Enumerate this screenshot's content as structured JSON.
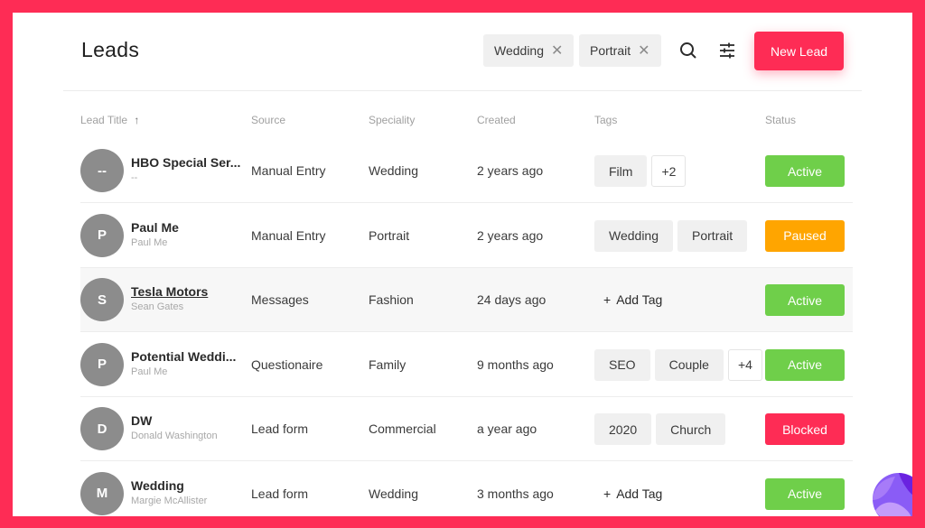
{
  "header": {
    "title": "Leads",
    "filters": [
      {
        "label": "Wedding",
        "remove_icon": "close-icon"
      },
      {
        "label": "Portrait",
        "remove_icon": "close-icon"
      }
    ],
    "search_icon": "search-icon",
    "filter_icon": "sliders-icon",
    "new_lead_label": "New Lead"
  },
  "colors": {
    "brand": "#fe2c55",
    "active": "#6fcf4a",
    "paused": "#ffa500",
    "blocked": "#fe2c55",
    "avatar": "#8c8c8c"
  },
  "table": {
    "columns": [
      "Lead Title",
      "Source",
      "Speciality",
      "Created",
      "Tags",
      "Status"
    ],
    "sort_icon": "arrow-up-icon",
    "add_tag_label": "Add Tag",
    "rows": [
      {
        "initial": "--",
        "title": "HBO Special Ser...",
        "subtitle": "--",
        "source": "Manual Entry",
        "speciality": "Wedding",
        "created": "2 years ago",
        "tags": [
          "Film"
        ],
        "more": "+2",
        "status": "Active"
      },
      {
        "initial": "P",
        "title": "Paul Me",
        "subtitle": "Paul Me",
        "source": "Manual Entry",
        "speciality": "Portrait",
        "created": "2 years ago",
        "tags": [
          "Wedding",
          "Portrait"
        ],
        "more": "",
        "status": "Paused"
      },
      {
        "initial": "S",
        "title": "Tesla Motors",
        "subtitle": "Sean Gates",
        "source": "Messages",
        "speciality": "Fashion",
        "created": "24 days ago",
        "tags": [],
        "more": "",
        "status": "Active"
      },
      {
        "initial": "P",
        "title": "Potential Weddi...",
        "subtitle": "Paul Me",
        "source": "Questionaire",
        "speciality": "Family",
        "created": "9 months ago",
        "tags": [
          "SEO",
          "Couple"
        ],
        "more": "+4",
        "status": "Active"
      },
      {
        "initial": "D",
        "title": "DW",
        "subtitle": "Donald Washington",
        "source": "Lead form",
        "speciality": "Commercial",
        "created": "a year ago",
        "tags": [
          "2020",
          "Church"
        ],
        "more": "",
        "status": "Blocked"
      },
      {
        "initial": "M",
        "title": "Wedding",
        "subtitle": "Margie McAllister",
        "source": "Lead form",
        "speciality": "Wedding",
        "created": "3 months ago",
        "tags": [],
        "more": "",
        "status": "Active"
      }
    ]
  }
}
